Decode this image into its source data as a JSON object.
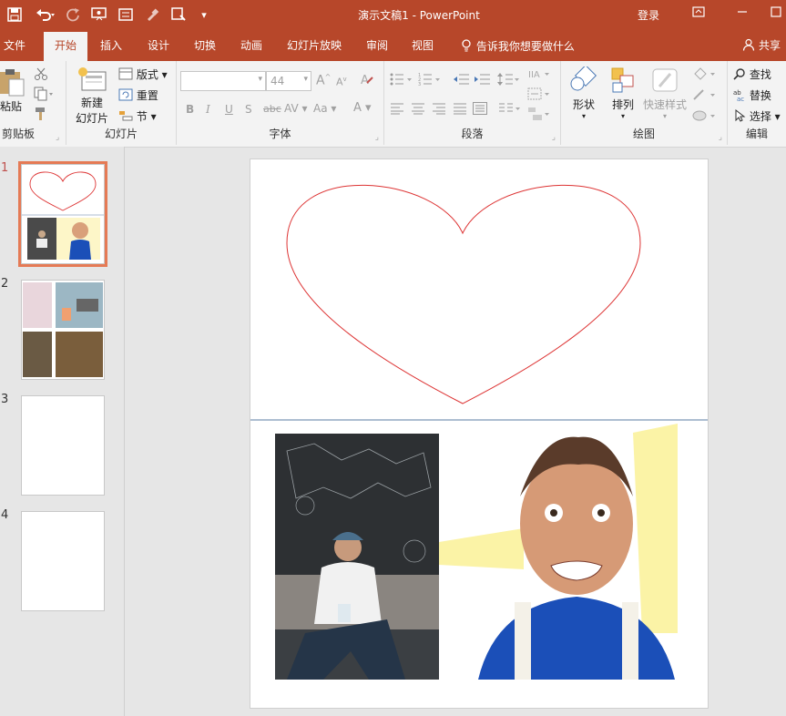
{
  "quick_access": {
    "save_icon": "save-icon",
    "undo_icon": "undo-icon",
    "redo_icon": "redo-icon",
    "start_icon": "slideshow-start-icon",
    "customize": "▾"
  },
  "window": {
    "title": "演示文稿1  -  PowerPoint",
    "login": "登录"
  },
  "tabs": [
    "文件",
    "开始",
    "插入",
    "设计",
    "切换",
    "动画",
    "幻灯片放映",
    "审阅",
    "视图"
  ],
  "search": {
    "label": "告诉我你想要做什么"
  },
  "share": {
    "label": "共享"
  },
  "ribbon": {
    "clipboard": {
      "paste": "粘贴",
      "label": "剪贴板"
    },
    "slides": {
      "new_slide_line1": "新建",
      "new_slide_line2": "幻灯片",
      "layout": "版式",
      "reset": "重置",
      "section": "节",
      "label": "幻灯片"
    },
    "font": {
      "font_name": "",
      "font_size": "44",
      "bold": "B",
      "italic": "I",
      "underline": "U",
      "shadow": "S",
      "strike": "abc",
      "spacing": "AV",
      "case": "Aa",
      "color": "A",
      "label": "字体"
    },
    "paragraph": {
      "label": "段落"
    },
    "drawing": {
      "shapes": "形状",
      "arrange": "排列",
      "quick_styles": "快速样式",
      "label": "绘图"
    },
    "editing": {
      "find": "查找",
      "replace": "替换",
      "select": "选择",
      "label": "编辑"
    }
  },
  "slides": [
    {
      "number": "1"
    },
    {
      "number": "2"
    },
    {
      "number": "3"
    },
    {
      "number": "4"
    }
  ],
  "colors": {
    "accent": "#b7472a",
    "selection": "#e57a55",
    "heart_stroke": "#d33",
    "divider": "#5b7ea3"
  }
}
